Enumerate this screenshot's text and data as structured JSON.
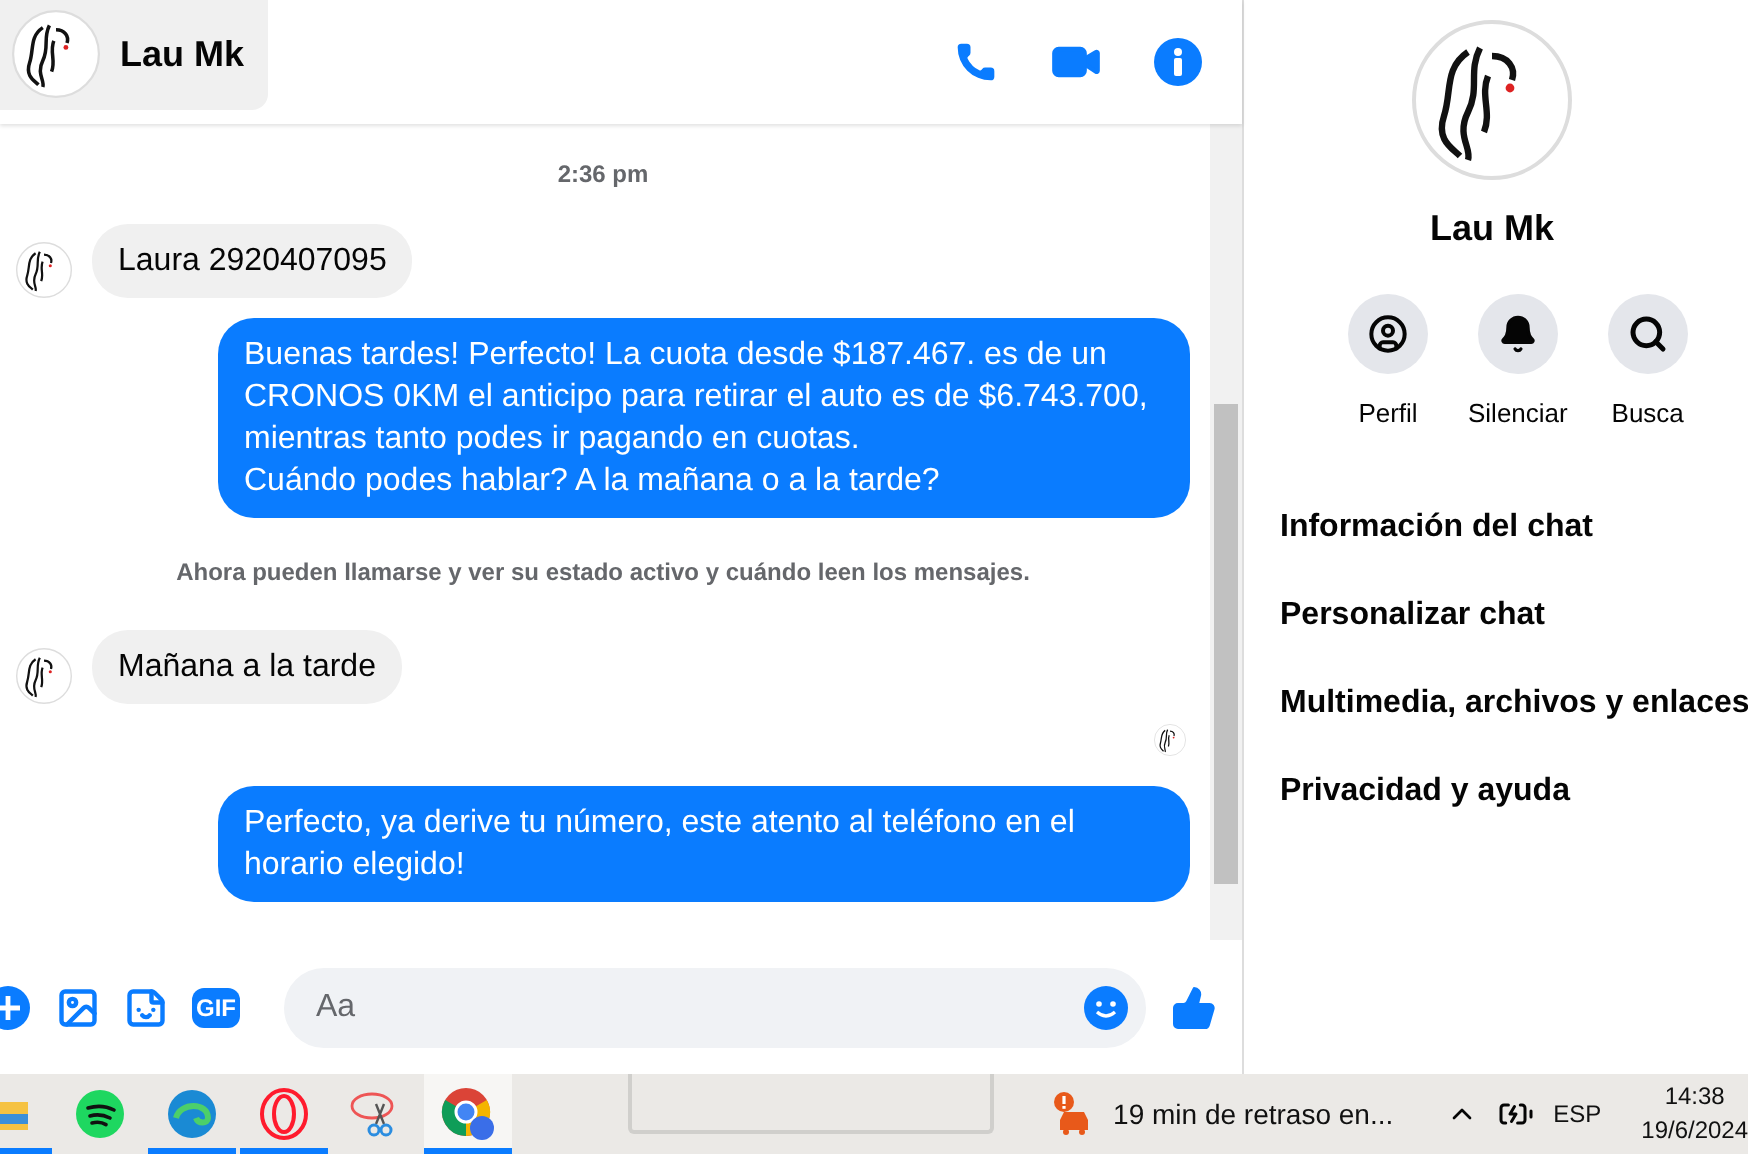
{
  "chat": {
    "contact_name": "Lau Mk",
    "messages": [
      {
        "kind": "time",
        "text": "2:36 pm"
      },
      {
        "kind": "incoming",
        "text": "Laura 2920407095"
      },
      {
        "kind": "outgoing",
        "text": "Buenas tardes! Perfecto! La cuota desde $187.467. es de un CRONOS 0KM el anticipo para retirar el auto es de $6.743.700, mientras tanto podes ir pagando en cuotas.\nCuándo podes hablar? A la mañana o a la tarde?"
      },
      {
        "kind": "notice",
        "text": "Ahora pueden llamarse y ver su estado activo y cuándo leen los mensajes."
      },
      {
        "kind": "incoming",
        "text": "Mañana a la tarde"
      },
      {
        "kind": "seen"
      },
      {
        "kind": "outgoing",
        "text": "Perfecto, ya derive tu número, este atento al teléfono en el horario elegido!"
      }
    ],
    "composer": {
      "gif_label": "GIF",
      "placeholder": "Aa"
    }
  },
  "info_panel": {
    "name": "Lau Mk",
    "actions": [
      {
        "kind": "profile",
        "label": "Perfil"
      },
      {
        "kind": "mute",
        "label": "Silenciar"
      },
      {
        "kind": "search",
        "label": "Busca"
      }
    ],
    "sections": [
      "Información del chat",
      "Personalizar chat",
      "Multimedia, archivos y enlaces",
      "Privacidad y ayuda"
    ]
  },
  "taskbar": {
    "apps": [
      {
        "kind": "folder",
        "running": true,
        "selected": false
      },
      {
        "kind": "spotify",
        "running": false,
        "selected": false
      },
      {
        "kind": "edge",
        "running": true,
        "selected": false
      },
      {
        "kind": "opera",
        "running": true,
        "selected": false
      },
      {
        "kind": "snip",
        "running": false,
        "selected": false
      },
      {
        "kind": "chrome",
        "running": true,
        "selected": true
      }
    ],
    "notification": "19 min de retraso en...",
    "language": "ESP",
    "time": "14:38",
    "date": "19/6/2024"
  }
}
